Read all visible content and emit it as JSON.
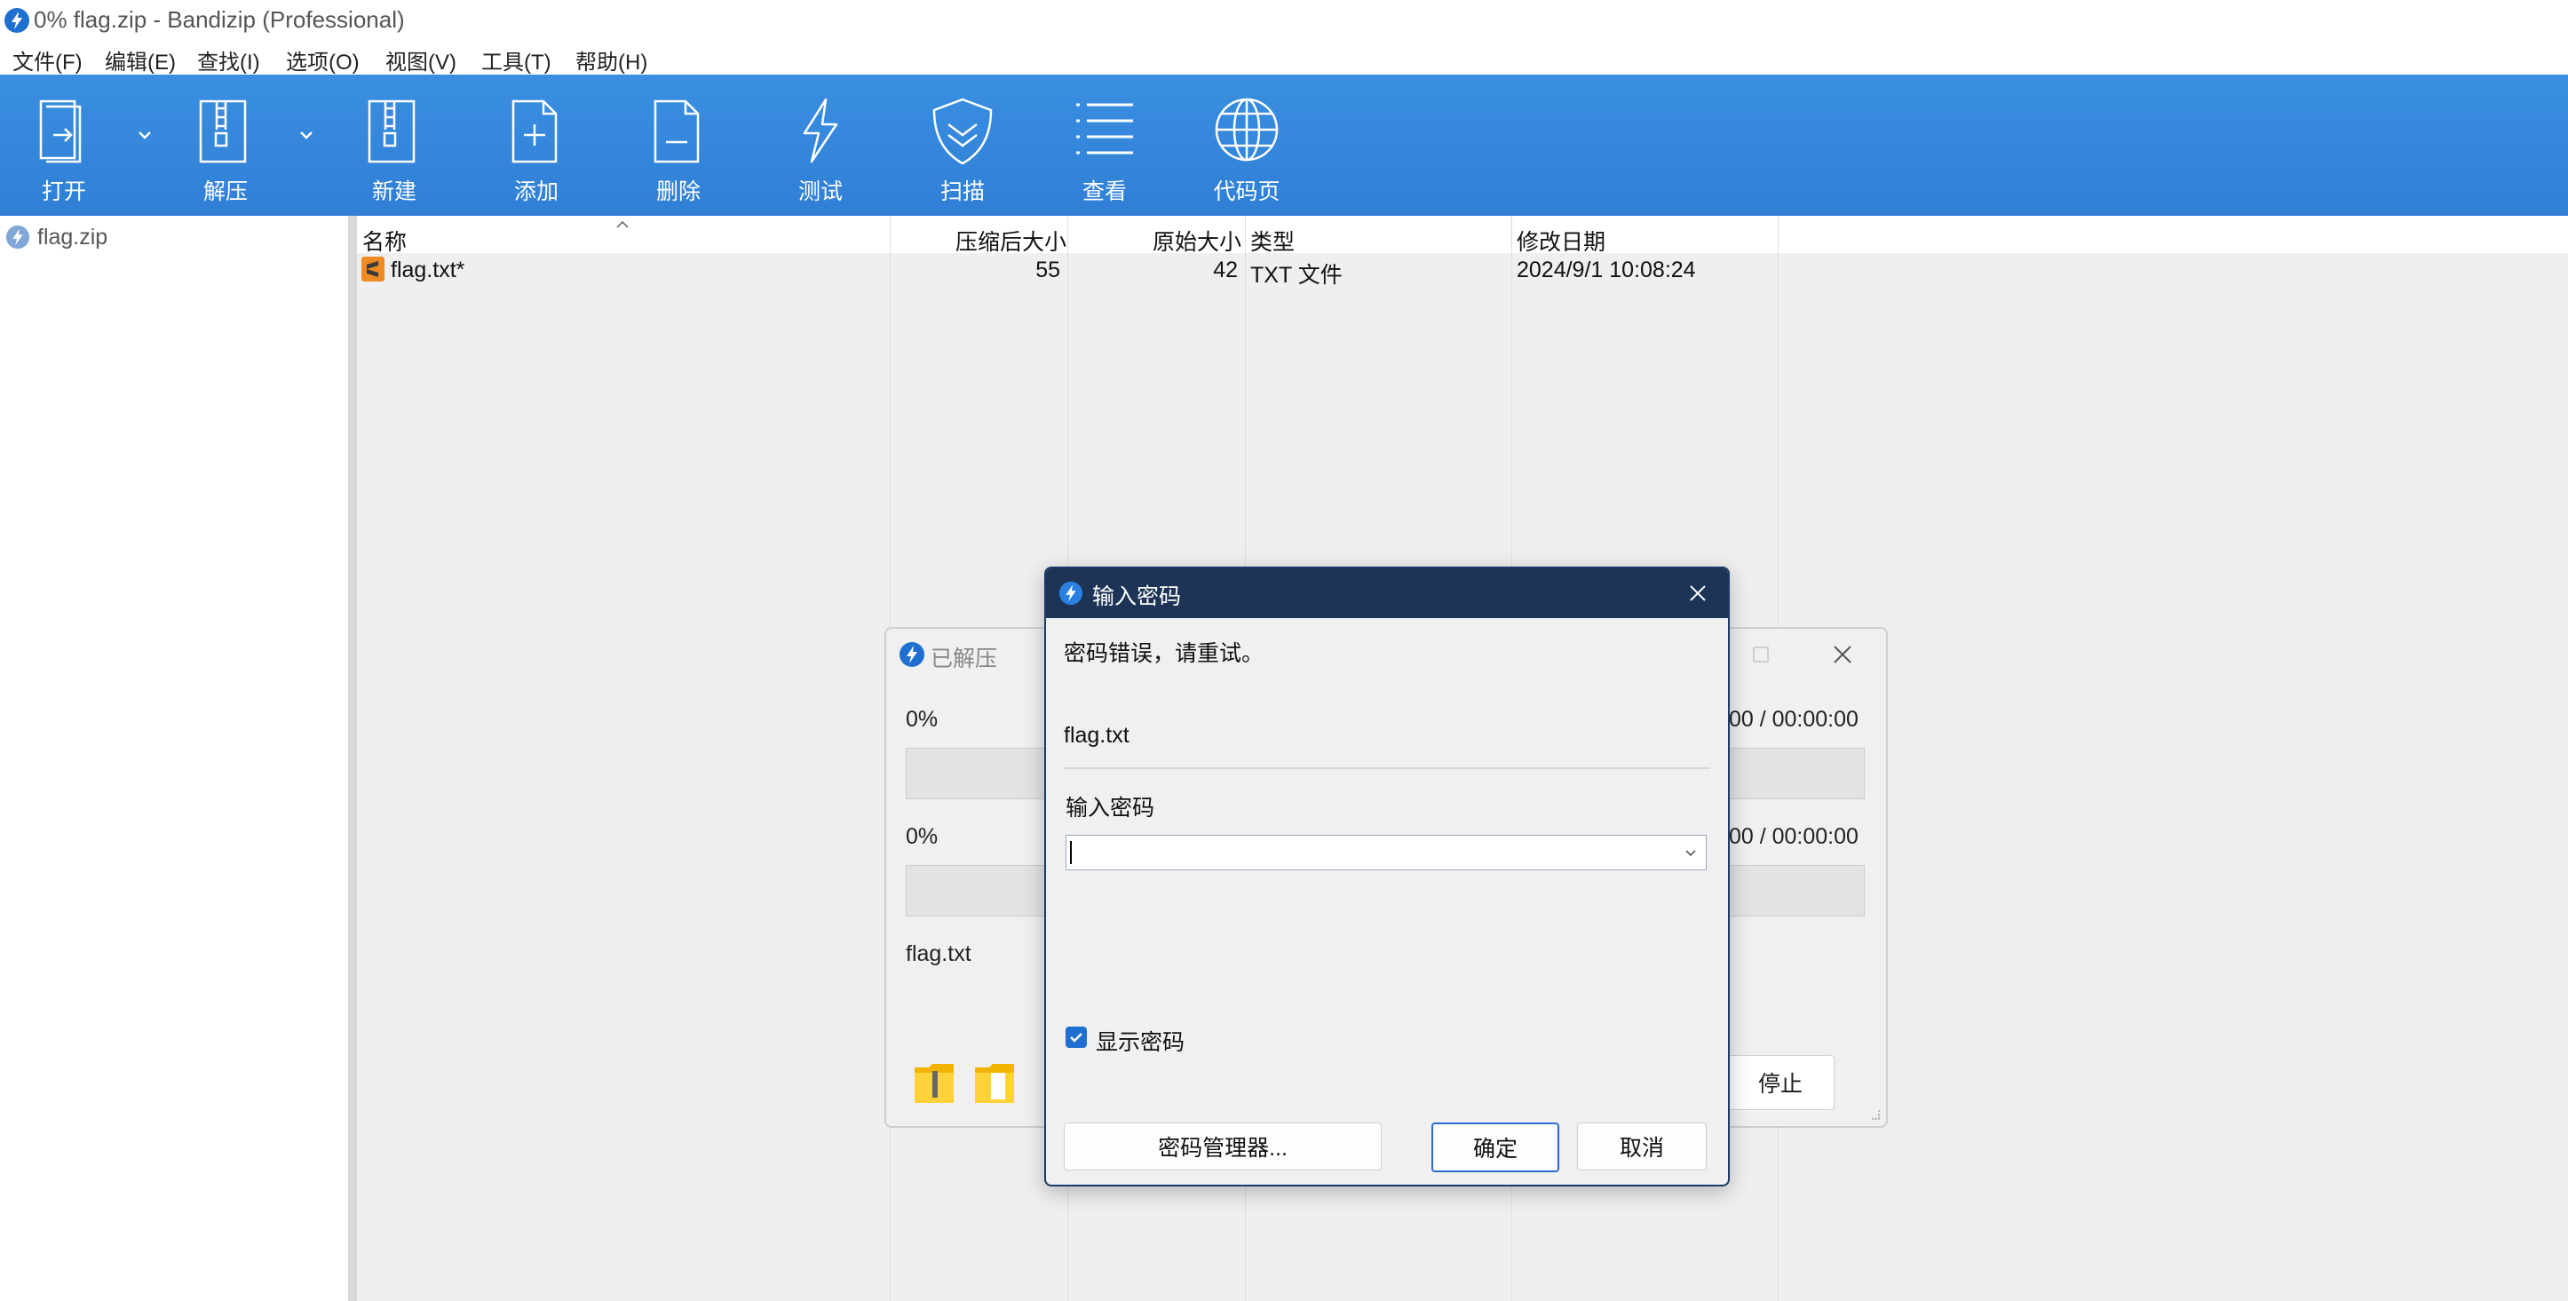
{
  "window": {
    "title": "0% flag.zip - Bandizip (Professional)"
  },
  "menu": [
    {
      "label": "文件(F)"
    },
    {
      "label": "编辑(E)"
    },
    {
      "label": "查找(I)"
    },
    {
      "label": "选项(O)"
    },
    {
      "label": "视图(V)"
    },
    {
      "label": "工具(T)"
    },
    {
      "label": "帮助(H)"
    }
  ],
  "toolbar": {
    "open": {
      "label": "打开",
      "icon": "open-icon"
    },
    "extract": {
      "label": "解压",
      "icon": "zip-extract-icon"
    },
    "new": {
      "label": "新建",
      "icon": "new-archive-icon"
    },
    "add": {
      "label": "添加",
      "icon": "add-file-icon"
    },
    "delete": {
      "label": "删除",
      "icon": "delete-file-icon"
    },
    "test": {
      "label": "测试",
      "icon": "lightning-icon"
    },
    "scan": {
      "label": "扫描",
      "icon": "shield-icon"
    },
    "view": {
      "label": "查看",
      "icon": "list-view-icon"
    },
    "codepage": {
      "label": "代码页",
      "icon": "globe-icon"
    }
  },
  "tree": {
    "items": [
      {
        "label": "flag.zip"
      }
    ]
  },
  "filelist": {
    "columns": {
      "name": "名称",
      "packed": "压缩后大小",
      "size": "原始大小",
      "type": "类型",
      "modified": "修改日期"
    },
    "rows": [
      {
        "name": "flag.txt*",
        "packed": "55",
        "size": "42",
        "type": "TXT 文件",
        "modified": "2024/9/1 10:08:24"
      }
    ]
  },
  "extract_dialog": {
    "title": "已解压",
    "progress1_percent": "0%",
    "progress1_time": ":00 / 00:00:00",
    "progress2_percent": "0%",
    "progress2_time": ":00 / 00:00:00",
    "progress1_value": 0,
    "progress2_value": 0,
    "current_file": "flag.txt",
    "stop_label": "停止"
  },
  "password_dialog": {
    "title": "输入密码",
    "error_message": "密码错误，请重试。",
    "filename": "flag.txt",
    "input_label": "输入密码",
    "password_value": "",
    "show_password_label": "显示密码",
    "show_password_checked": true,
    "manager_button": "密码管理器...",
    "ok_button": "确定",
    "cancel_button": "取消"
  },
  "colors": {
    "toolbar_bg": "#2f80d6",
    "dialog_titlebar": "#1d3457",
    "checkbox": "#1f6fd1"
  }
}
